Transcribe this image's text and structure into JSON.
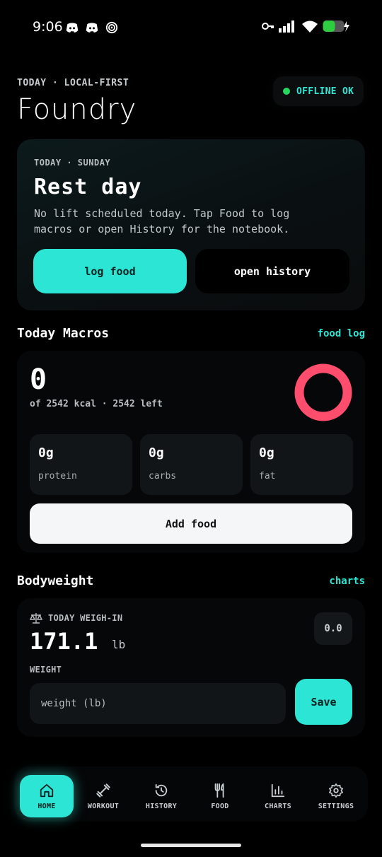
{
  "status_bar": {
    "time": "9:06"
  },
  "header": {
    "subtitle": "TODAY · LOCAL-FIRST",
    "title": "Foundry",
    "offline_badge": "OFFLINE OK"
  },
  "today_card": {
    "kicker": "TODAY · SUNDAY",
    "title": "Rest day",
    "description": "No lift scheduled today. Tap Food to log macros or open History for the notebook.",
    "primary_button": "log food",
    "secondary_button": "open history"
  },
  "macros": {
    "section_title": "Today Macros",
    "link": "food log",
    "kcal_value": "0",
    "kcal_sub": "of 2542 kcal · 2542 left",
    "progress_fraction": 0,
    "tiles": [
      {
        "value": "0g",
        "label": "protein"
      },
      {
        "value": "0g",
        "label": "carbs"
      },
      {
        "value": "0g",
        "label": "fat"
      }
    ],
    "add_button": "Add food"
  },
  "bodyweight": {
    "section_title": "Bodyweight",
    "link": "charts",
    "kicker": "TODAY WEIGH-IN",
    "value": "171.1",
    "unit": "lb",
    "delta": "0.0",
    "field_label": "WEIGHT",
    "input_placeholder": "weight (lb)",
    "save_button": "Save"
  },
  "nav": {
    "items": [
      {
        "label": "HOME",
        "icon": "home-icon"
      },
      {
        "label": "WORKOUT",
        "icon": "dumbbell-icon"
      },
      {
        "label": "HISTORY",
        "icon": "history-icon"
      },
      {
        "label": "FOOD",
        "icon": "utensils-icon"
      },
      {
        "label": "CHARTS",
        "icon": "bar-chart-icon"
      },
      {
        "label": "SETTINGS",
        "icon": "gear-icon"
      }
    ]
  },
  "colors": {
    "accent": "#2de5d4",
    "ring": "#ff4d6d",
    "online": "#27d65f"
  }
}
